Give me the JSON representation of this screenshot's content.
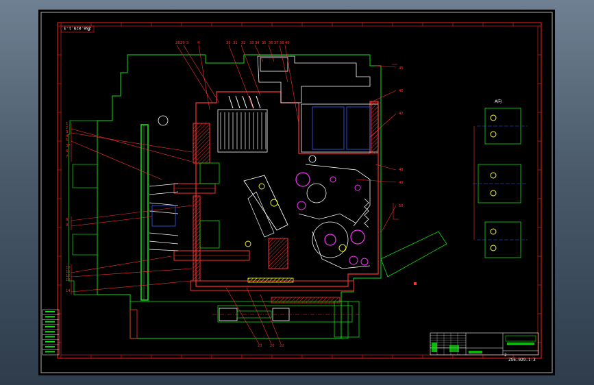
{
  "drawing": {
    "drawing_number_top": "ZS6.029.1-3",
    "drawing_number_bottom": "ZS6.029.1-3",
    "sheet_number_small": "2",
    "title_block_sheet": "2",
    "view_label": "A向",
    "callouts_top": [
      "28",
      "29",
      "3",
      "4",
      "30",
      "31",
      "32",
      "33",
      "34",
      "35",
      "36",
      "37",
      "38",
      "40"
    ],
    "callouts_right": [
      "45",
      "46",
      "47",
      "48",
      "49",
      "50"
    ],
    "callouts_left": [
      "1",
      "2",
      "3",
      "4",
      "5",
      "37",
      "6",
      "7",
      "8",
      "9",
      "10",
      "11",
      "12",
      "13",
      "14"
    ],
    "callouts_bottom": [
      "23",
      "20",
      "22"
    ]
  },
  "colors": {
    "background": "#000000",
    "frame": "#ff2020",
    "outline": "#10e010",
    "hatch": "#ff3030",
    "detail": "#ffffff",
    "accent": "#ffff20",
    "blue": "#3060ff",
    "magenta": "#ff30ff",
    "cyan": "#20e0e0"
  }
}
